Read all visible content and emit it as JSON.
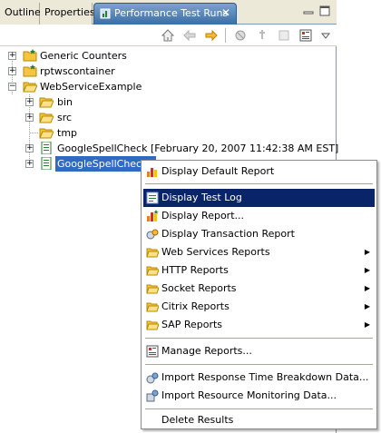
{
  "tabs": {
    "outline": "Outline",
    "properties": "Properties",
    "active": "Performance Test Runs"
  },
  "tree": {
    "items": [
      {
        "label": "Generic Counters"
      },
      {
        "label": "rptwscontainer"
      },
      {
        "label": "WebServiceExample"
      },
      {
        "label": "bin"
      },
      {
        "label": "src"
      },
      {
        "label": "tmp"
      },
      {
        "label": "GoogleSpellCheck [February 20, 2007 11:42:38 AM EST]"
      },
      {
        "label": "GoogleSpellCheck ["
      }
    ]
  },
  "menu": {
    "items": [
      {
        "label": "Display Default Report",
        "icon": "report-chart-icon"
      },
      {
        "label": "Display Test Log",
        "icon": "test-log-icon"
      },
      {
        "label": "Display Report...",
        "icon": "report-new-icon"
      },
      {
        "label": "Display Transaction Report",
        "icon": "transaction-icon"
      },
      {
        "label": "Web Services Reports",
        "icon": "folder-icon"
      },
      {
        "label": "HTTP Reports",
        "icon": "folder-icon"
      },
      {
        "label": "Socket Reports",
        "icon": "folder-icon"
      },
      {
        "label": "Citrix Reports",
        "icon": "folder-icon"
      },
      {
        "label": "SAP Reports",
        "icon": "folder-icon"
      },
      {
        "label": "Manage Reports...",
        "icon": "manage-reports-icon"
      },
      {
        "label": "Import Response Time Breakdown Data...",
        "icon": "import-breakdown-icon"
      },
      {
        "label": "Import Resource Monitoring Data...",
        "icon": "import-monitoring-icon"
      },
      {
        "label": "Delete Results",
        "icon": ""
      }
    ]
  },
  "colors": {
    "selection": "#316ac5",
    "menu_highlight": "#0a246a",
    "tab_active": "#3a6ea5",
    "folder": "#f5c542"
  }
}
